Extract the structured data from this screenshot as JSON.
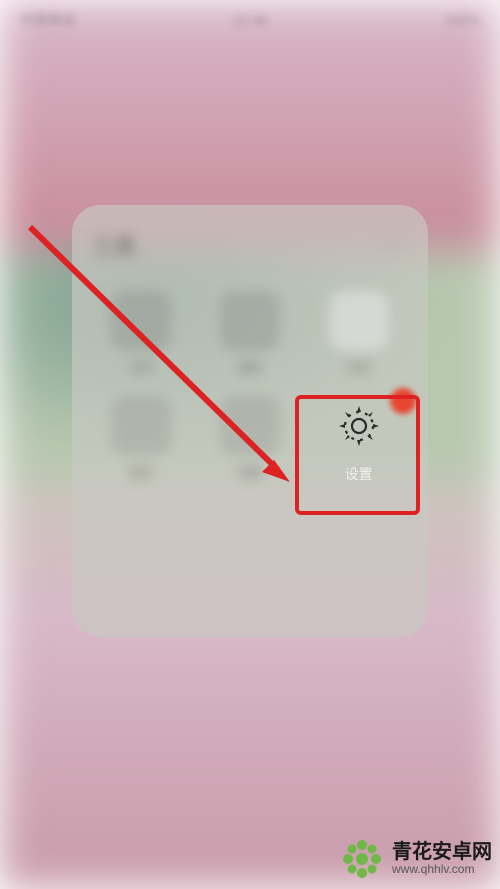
{
  "status": {
    "left": "中国电信",
    "center": "10:36",
    "right": "100%"
  },
  "folder": {
    "title": "工具",
    "apps": [
      {
        "label": "文件"
      },
      {
        "label": "相机"
      },
      {
        "label": "日历"
      },
      {
        "label": "音乐"
      },
      {
        "label": "视频"
      },
      {
        "label": "设置"
      }
    ]
  },
  "highlight": {
    "target_label": "设置",
    "icon_name": "gear-icon"
  },
  "watermark": {
    "brand": "青花安卓网",
    "url": "www.qhhlv.com"
  },
  "colors": {
    "highlight_border": "#dc2222",
    "arrow": "#dc2222",
    "badge": "#e84530",
    "wm_logo": "#6fb848"
  }
}
